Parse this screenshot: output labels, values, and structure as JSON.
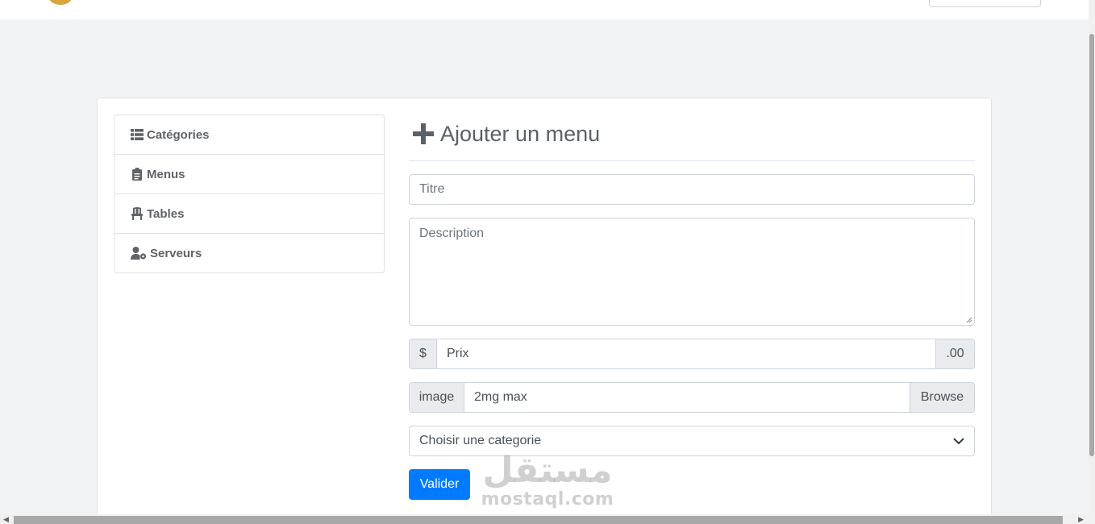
{
  "sidebar": {
    "items": [
      {
        "label": "Catégories",
        "icon": "list-icon"
      },
      {
        "label": "Menus",
        "icon": "clipboard-icon"
      },
      {
        "label": "Tables",
        "icon": "chair-icon"
      },
      {
        "label": "Serveurs",
        "icon": "user-cog-icon"
      }
    ]
  },
  "form": {
    "title": "Ajouter un menu",
    "titre_placeholder": "Titre",
    "description_placeholder": "Description",
    "price": {
      "prefix": "$",
      "placeholder": "Prix",
      "suffix": ".00"
    },
    "image": {
      "label": "image",
      "hint": "2mg max",
      "browse": "Browse"
    },
    "category_select": "Choisir une categorie",
    "submit": "Valider"
  },
  "watermark": {
    "arabic": "مستقل",
    "latin": "mostaql.com"
  },
  "colors": {
    "primary": "#007bff",
    "background": "#f2f3f4",
    "addon": "#e9ecef"
  }
}
